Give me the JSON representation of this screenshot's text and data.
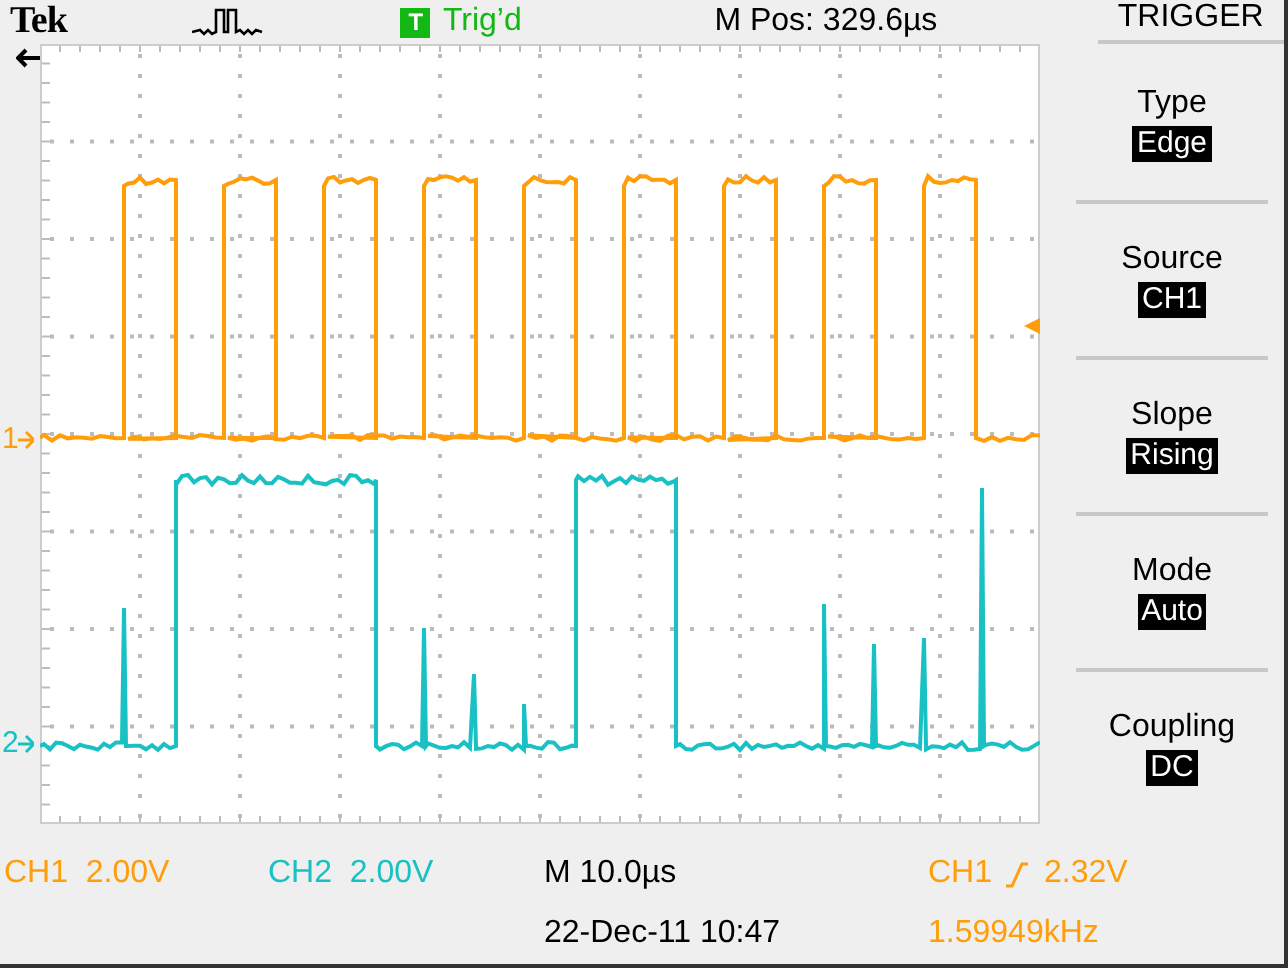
{
  "header": {
    "brand": "Tek",
    "trigger_badge": "T",
    "trigger_status": "Trig’d",
    "position": "M Pos: 329.6µs"
  },
  "channels": [
    {
      "marker": "1",
      "label": "CH1",
      "scale": "2.00V",
      "color": "#ff9d0a"
    },
    {
      "marker": "2",
      "label": "CH2",
      "scale": "2.00V",
      "color": "#19c1c4"
    }
  ],
  "menu": {
    "title": "TRIGGER",
    "items": [
      {
        "label": "Type",
        "value": "Edge"
      },
      {
        "label": "Source",
        "value": "CH1"
      },
      {
        "label": "Slope",
        "value": "Rising"
      },
      {
        "label": "Mode",
        "value": "Auto"
      },
      {
        "label": "Coupling",
        "value": "DC"
      }
    ]
  },
  "status": {
    "timebase": "M 10.0µs",
    "datetime": "22-Dec-11 10:47",
    "trigger_source": "CH1",
    "trigger_level": "2.32V",
    "frequency": "1.59949kHz"
  }
}
